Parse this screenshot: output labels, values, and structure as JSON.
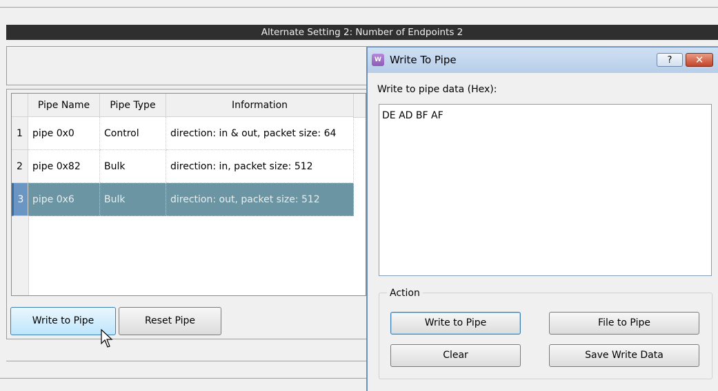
{
  "main": {
    "alt_setting_title": "Alternate Setting 2: Number of Endpoints 2",
    "table": {
      "columns": [
        "Pipe Name",
        "Pipe Type",
        "Information"
      ],
      "rows": [
        {
          "index": "1",
          "name": "pipe 0x0",
          "type": "Control",
          "info": "direction: in & out, packet size: 64"
        },
        {
          "index": "2",
          "name": "pipe 0x82",
          "type": "Bulk",
          "info": "direction: in, packet size: 512"
        },
        {
          "index": "3",
          "name": "pipe 0x6",
          "type": "Bulk",
          "info": "direction: out, packet size: 512"
        }
      ],
      "selected_row": 3
    },
    "buttons": {
      "write_to_pipe": "Write to Pipe",
      "reset_pipe": "Reset Pipe"
    }
  },
  "dialog": {
    "title": "Write To Pipe",
    "help_glyph": "?",
    "close_glyph": "✕",
    "data_label": "Write to pipe data (Hex):",
    "hex_value": "DE AD BF AF",
    "action_group_label": "Action",
    "buttons": {
      "write_to_pipe": "Write to Pipe",
      "file_to_pipe": "File to Pipe",
      "clear": "Clear",
      "save_write_data": "Save Write Data"
    }
  },
  "colors": {
    "selected_row": "#6b95a3",
    "title_bar": "#b7cde8",
    "close_button": "#c2452a"
  }
}
